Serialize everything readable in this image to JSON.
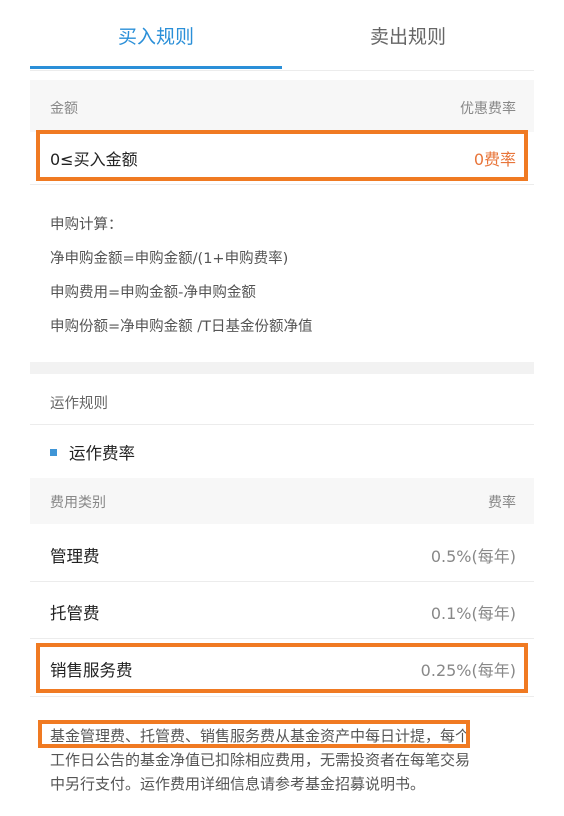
{
  "tabs": {
    "buy": "买入规则",
    "sell": "卖出规则"
  },
  "fee_header": {
    "left": "金额",
    "right": "优惠费率"
  },
  "amount_row": {
    "left": "0≤买入金额",
    "right": "0费率"
  },
  "calc": {
    "title": "申购计算：",
    "line1": "净申购金额=申购金额/(1+申购费率)",
    "line2": "申购费用=申购金额-净申购金额",
    "line3": "申购份额=净申购金额 /T日基金份额净值"
  },
  "ops": {
    "title": "运作规则",
    "section": "运作费率"
  },
  "fee_table": {
    "header_left": "费用类别",
    "header_right": "费率",
    "rows": [
      {
        "name": "管理费",
        "rate": "0.5%(每年)"
      },
      {
        "name": "托管费",
        "rate": "0.1%(每年)"
      },
      {
        "name": "销售服务费",
        "rate": "0.25%(每年)"
      }
    ]
  },
  "note": {
    "line1": "基金管理费、托管费、销售服务费从基金资产中每日计提，每个",
    "line2": "工作日公告的基金净值已扣除相应费用，无需投资者在每笔交易",
    "line3": "中另行支付。运作费用详细信息请参考基金招募说明书。"
  },
  "colors": {
    "accent": "#2a8fd8",
    "highlight": "#e8753a",
    "annotation_box": "#f07a22"
  }
}
